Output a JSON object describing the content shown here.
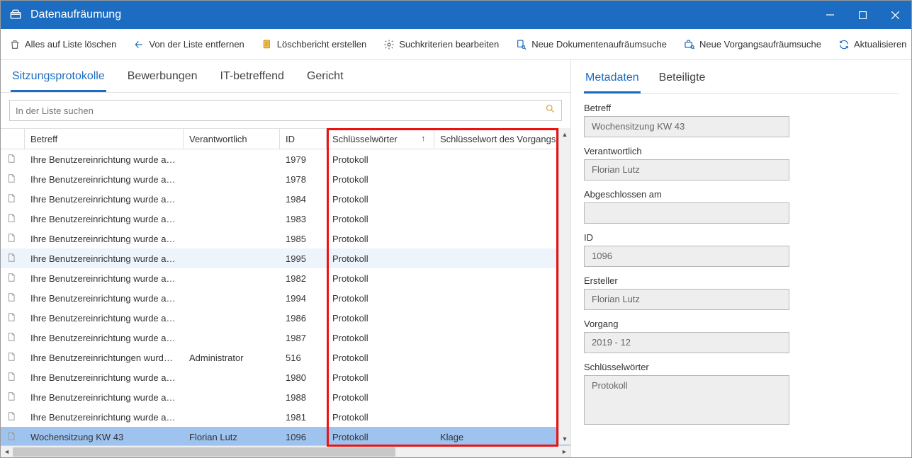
{
  "window": {
    "title": "Datenaufräumung"
  },
  "toolbar": [
    {
      "id": "delete-all",
      "label": "Alles auf Liste löschen",
      "icon": "trash"
    },
    {
      "id": "remove",
      "label": "Von der Liste entfernen",
      "icon": "back"
    },
    {
      "id": "report",
      "label": "Löschbericht erstellen",
      "icon": "doc"
    },
    {
      "id": "criteria",
      "label": "Suchkriterien bearbeiten",
      "icon": "gear"
    },
    {
      "id": "doc-search",
      "label": "Neue Dokumentenaufräumsuche",
      "icon": "doc-search"
    },
    {
      "id": "case-search",
      "label": "Neue Vorgangsaufräumsuche",
      "icon": "case-search"
    },
    {
      "id": "refresh",
      "label": "Aktualisieren",
      "icon": "refresh"
    }
  ],
  "main_tabs": [
    {
      "id": "sitzungsprotokolle",
      "label": "Sitzungsprotokolle",
      "active": true
    },
    {
      "id": "bewerbungen",
      "label": "Bewerbungen",
      "active": false
    },
    {
      "id": "it",
      "label": "IT-betreffend",
      "active": false
    },
    {
      "id": "gericht",
      "label": "Gericht",
      "active": false
    }
  ],
  "search": {
    "placeholder": "In der Liste suchen"
  },
  "columns": {
    "betreff": "Betreff",
    "verantwortlich": "Verantwortlich",
    "id": "ID",
    "keywords": "Schlüsselwörter",
    "vorgang_keyword": "Schlüsselwort des Vorgangs"
  },
  "rows": [
    {
      "betreff": "Ihre Benutzereinrichtung wurde aktua...",
      "verantwortlich": "",
      "id": "1979",
      "keywords": "Protokoll",
      "vorg": ""
    },
    {
      "betreff": "Ihre Benutzereinrichtung wurde aktua...",
      "verantwortlich": "",
      "id": "1978",
      "keywords": "Protokoll",
      "vorg": ""
    },
    {
      "betreff": "Ihre Benutzereinrichtung wurde aktua...",
      "verantwortlich": "",
      "id": "1984",
      "keywords": "Protokoll",
      "vorg": ""
    },
    {
      "betreff": "Ihre Benutzereinrichtung wurde aktua...",
      "verantwortlich": "",
      "id": "1983",
      "keywords": "Protokoll",
      "vorg": ""
    },
    {
      "betreff": "Ihre Benutzereinrichtung wurde aktua...",
      "verantwortlich": "",
      "id": "1985",
      "keywords": "Protokoll",
      "vorg": ""
    },
    {
      "betreff": "Ihre Benutzereinrichtung wurde aktua...",
      "verantwortlich": "",
      "id": "1995",
      "keywords": "Protokoll",
      "vorg": "",
      "hover": true
    },
    {
      "betreff": "Ihre Benutzereinrichtung wurde aktua...",
      "verantwortlich": "",
      "id": "1982",
      "keywords": "Protokoll",
      "vorg": ""
    },
    {
      "betreff": "Ihre Benutzereinrichtung wurde aktua...",
      "verantwortlich": "",
      "id": "1994",
      "keywords": "Protokoll",
      "vorg": ""
    },
    {
      "betreff": "Ihre Benutzereinrichtung wurde aktua...",
      "verantwortlich": "",
      "id": "1986",
      "keywords": "Protokoll",
      "vorg": ""
    },
    {
      "betreff": "Ihre Benutzereinrichtung wurde aktua...",
      "verantwortlich": "",
      "id": "1987",
      "keywords": "Protokoll",
      "vorg": ""
    },
    {
      "betreff": "Ihre Benutzereinrichtungen wurden akt...",
      "verantwortlich": "Administrator",
      "id": "516",
      "keywords": "Protokoll",
      "vorg": ""
    },
    {
      "betreff": "Ihre Benutzereinrichtung wurde aktua...",
      "verantwortlich": "",
      "id": "1980",
      "keywords": "Protokoll",
      "vorg": ""
    },
    {
      "betreff": "Ihre Benutzereinrichtung wurde aktua...",
      "verantwortlich": "",
      "id": "1988",
      "keywords": "Protokoll",
      "vorg": ""
    },
    {
      "betreff": "Ihre Benutzereinrichtung wurde aktua...",
      "verantwortlich": "",
      "id": "1981",
      "keywords": "Protokoll",
      "vorg": ""
    },
    {
      "betreff": "Wochensitzung KW 43",
      "verantwortlich": "Florian Lutz",
      "id": "1096",
      "keywords": "Protokoll",
      "vorg": "Klage",
      "selected": true
    }
  ],
  "right_tabs": [
    {
      "id": "metadaten",
      "label": "Metadaten",
      "active": true
    },
    {
      "id": "beteiligte",
      "label": "Beteiligte",
      "active": false
    }
  ],
  "metadata": {
    "betreff_label": "Betreff",
    "betreff": "Wochensitzung KW 43",
    "verantwortlich_label": "Verantwortlich",
    "verantwortlich": "Florian Lutz",
    "abgeschlossen_label": "Abgeschlossen am",
    "abgeschlossen": "",
    "id_label": "ID",
    "id": "1096",
    "ersteller_label": "Ersteller",
    "ersteller": "Florian Lutz",
    "vorgang_label": "Vorgang",
    "vorgang": "2019 - 12",
    "keywords_label": "Schlüsselwörter",
    "keywords": "Protokoll"
  }
}
